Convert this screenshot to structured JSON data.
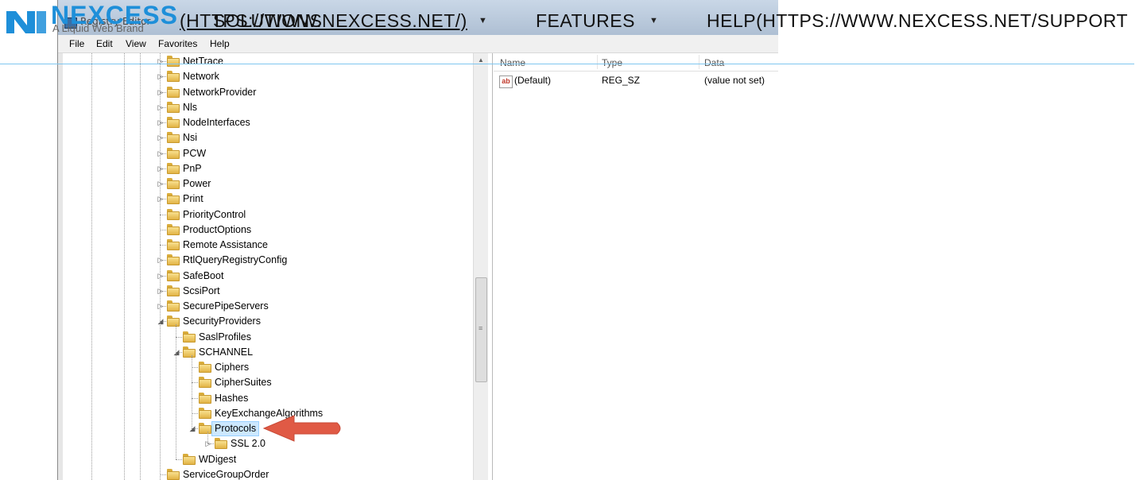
{
  "site": {
    "brand": "NEXCESS",
    "tagline": "A Liquid Web Brand",
    "nav": [
      {
        "label": "(HTTPS://WWW.NEXCESS.NET/)",
        "has_caret": false
      },
      {
        "label": "SOLUTIONS",
        "has_caret": true
      },
      {
        "label": "FEATURES",
        "has_caret": true
      },
      {
        "label": "HELP(HTTPS://WWW.NEXCESS.NET/SUPPORT",
        "has_caret": false
      }
    ],
    "colors": {
      "brand_blue": "#1e8fd9",
      "rule": "#7fc6ef"
    }
  },
  "window": {
    "title": "Registry Editor",
    "menu": [
      "File",
      "Edit",
      "View",
      "Favorites",
      "Help"
    ]
  },
  "tree": {
    "items": [
      {
        "label": "NetTrace",
        "depth": 0,
        "expander": "collapsed"
      },
      {
        "label": "Network",
        "depth": 0,
        "expander": "collapsed"
      },
      {
        "label": "NetworkProvider",
        "depth": 0,
        "expander": "collapsed"
      },
      {
        "label": "Nls",
        "depth": 0,
        "expander": "collapsed"
      },
      {
        "label": "NodeInterfaces",
        "depth": 0,
        "expander": "collapsed"
      },
      {
        "label": "Nsi",
        "depth": 0,
        "expander": "collapsed"
      },
      {
        "label": "PCW",
        "depth": 0,
        "expander": "collapsed"
      },
      {
        "label": "PnP",
        "depth": 0,
        "expander": "collapsed"
      },
      {
        "label": "Power",
        "depth": 0,
        "expander": "collapsed"
      },
      {
        "label": "Print",
        "depth": 0,
        "expander": "collapsed"
      },
      {
        "label": "PriorityControl",
        "depth": 0,
        "expander": "none"
      },
      {
        "label": "ProductOptions",
        "depth": 0,
        "expander": "none"
      },
      {
        "label": "Remote Assistance",
        "depth": 0,
        "expander": "none"
      },
      {
        "label": "RtlQueryRegistryConfig",
        "depth": 0,
        "expander": "collapsed"
      },
      {
        "label": "SafeBoot",
        "depth": 0,
        "expander": "collapsed"
      },
      {
        "label": "ScsiPort",
        "depth": 0,
        "expander": "collapsed"
      },
      {
        "label": "SecurePipeServers",
        "depth": 0,
        "expander": "collapsed"
      },
      {
        "label": "SecurityProviders",
        "depth": 0,
        "expander": "expanded"
      },
      {
        "label": "SaslProfiles",
        "depth": 1,
        "expander": "none"
      },
      {
        "label": "SCHANNEL",
        "depth": 1,
        "expander": "expanded"
      },
      {
        "label": "Ciphers",
        "depth": 2,
        "expander": "none"
      },
      {
        "label": "CipherSuites",
        "depth": 2,
        "expander": "none"
      },
      {
        "label": "Hashes",
        "depth": 2,
        "expander": "none"
      },
      {
        "label": "KeyExchangeAlgorithms",
        "depth": 2,
        "expander": "none"
      },
      {
        "label": "Protocols",
        "depth": 2,
        "expander": "expanded",
        "selected": true
      },
      {
        "label": "SSL 2.0",
        "depth": 3,
        "expander": "collapsed"
      },
      {
        "label": "WDigest",
        "depth": 1,
        "expander": "none"
      },
      {
        "label": "ServiceGroupOrder",
        "depth": 0,
        "expander": "none"
      }
    ]
  },
  "values": {
    "headers": {
      "name": "Name",
      "type": "Type",
      "data": "Data"
    },
    "rows": [
      {
        "name": "(Default)",
        "type": "REG_SZ",
        "data": "(value not set)",
        "icon": "string-value-icon"
      }
    ]
  },
  "annotation": {
    "arrow_color": "#e05a45",
    "points_to": "Protocols"
  }
}
